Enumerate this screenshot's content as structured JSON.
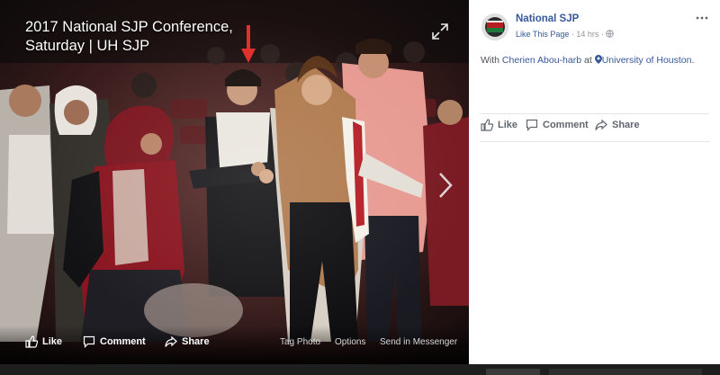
{
  "photo": {
    "title": "2017 National SJP Conference, Saturday | UH SJP",
    "alt": "Group of people dancing at a conference hall"
  },
  "photo_actions": {
    "like": "Like",
    "comment": "Comment",
    "share": "Share"
  },
  "photo_text_actions": {
    "tag": "Tag Photo",
    "options": "Options",
    "messenger": "Send in Messenger"
  },
  "post": {
    "page_name": "National SJP",
    "like_page": "Like This Page",
    "separator": "·",
    "time": "14 hrs",
    "with": "With",
    "with_person": "Cherien Abou-harb",
    "at": "at",
    "location": "University of Houston",
    "period": "."
  },
  "post_actions": {
    "like": "Like",
    "comment": "Comment",
    "share": "Share"
  },
  "colors": {
    "link": "#365899",
    "meta": "#90949c",
    "action": "#606770",
    "annotation_arrow": "#e2302b"
  },
  "icons": [
    "expand-icon",
    "next-arrow-icon",
    "like-icon",
    "comment-icon",
    "share-icon",
    "globe-icon",
    "location-pin-icon",
    "more-icon"
  ]
}
